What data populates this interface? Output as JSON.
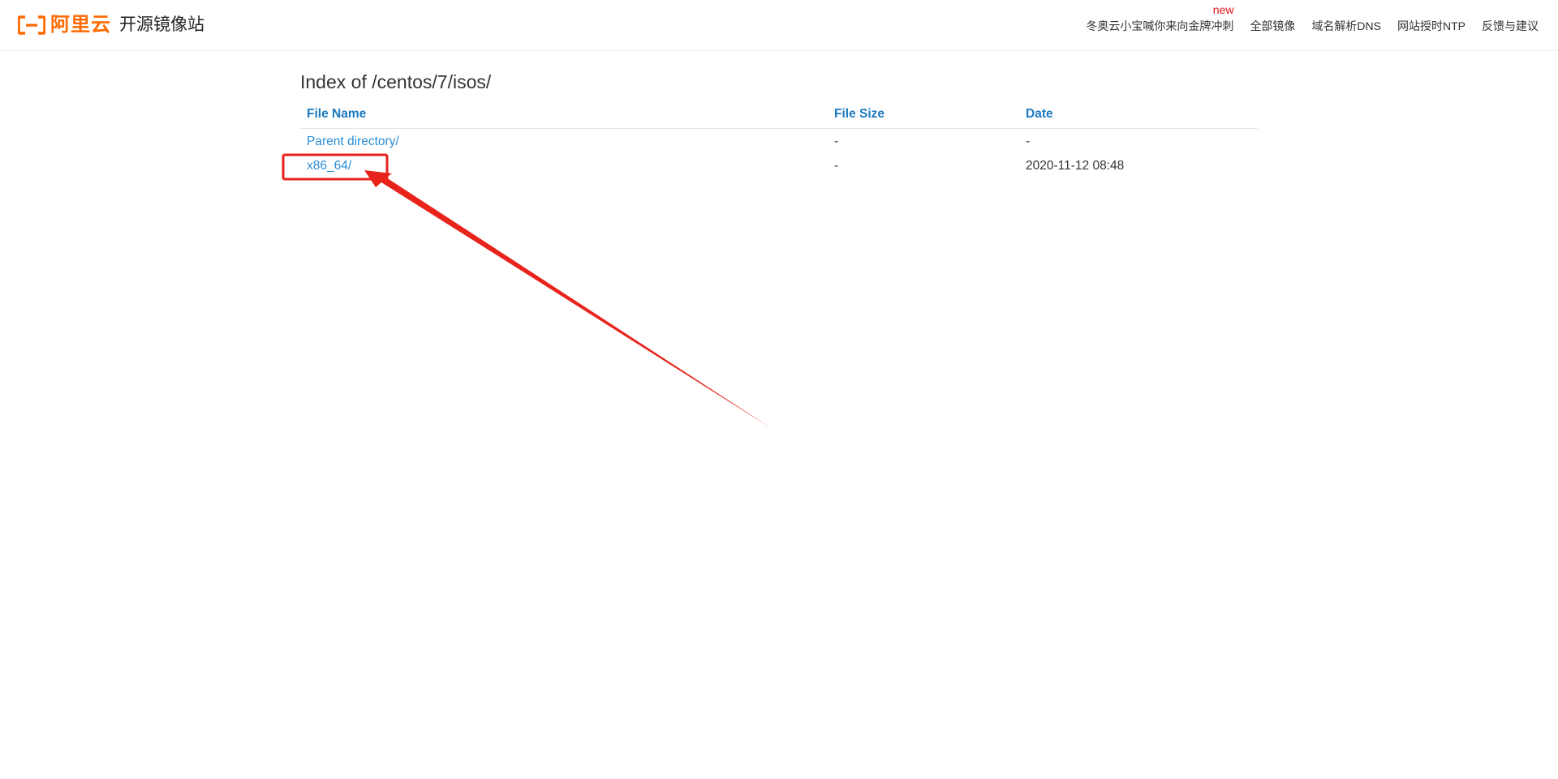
{
  "header": {
    "logo_text": "阿里云",
    "site_name": "开源镜像站",
    "nav": [
      {
        "label": "冬奥云小宝喊你来向金牌冲刺",
        "badge": "new"
      },
      {
        "label": "全部镜像"
      },
      {
        "label": "域名解析DNS"
      },
      {
        "label": "网站授时NTP"
      },
      {
        "label": "反馈与建议"
      }
    ]
  },
  "main": {
    "title": "Index of /centos/7/isos/",
    "columns": [
      "File Name",
      "File Size",
      "Date"
    ],
    "rows": [
      {
        "name": "Parent directory/",
        "size": "-",
        "date": "-"
      },
      {
        "name": "x86_64/",
        "size": "-",
        "date": "2020-11-12 08:48"
      }
    ]
  },
  "colors": {
    "brand": "#ff6a00",
    "link": "#2a8ed6",
    "header_link": "#1a7ac0",
    "annotation": "#e8231c"
  }
}
